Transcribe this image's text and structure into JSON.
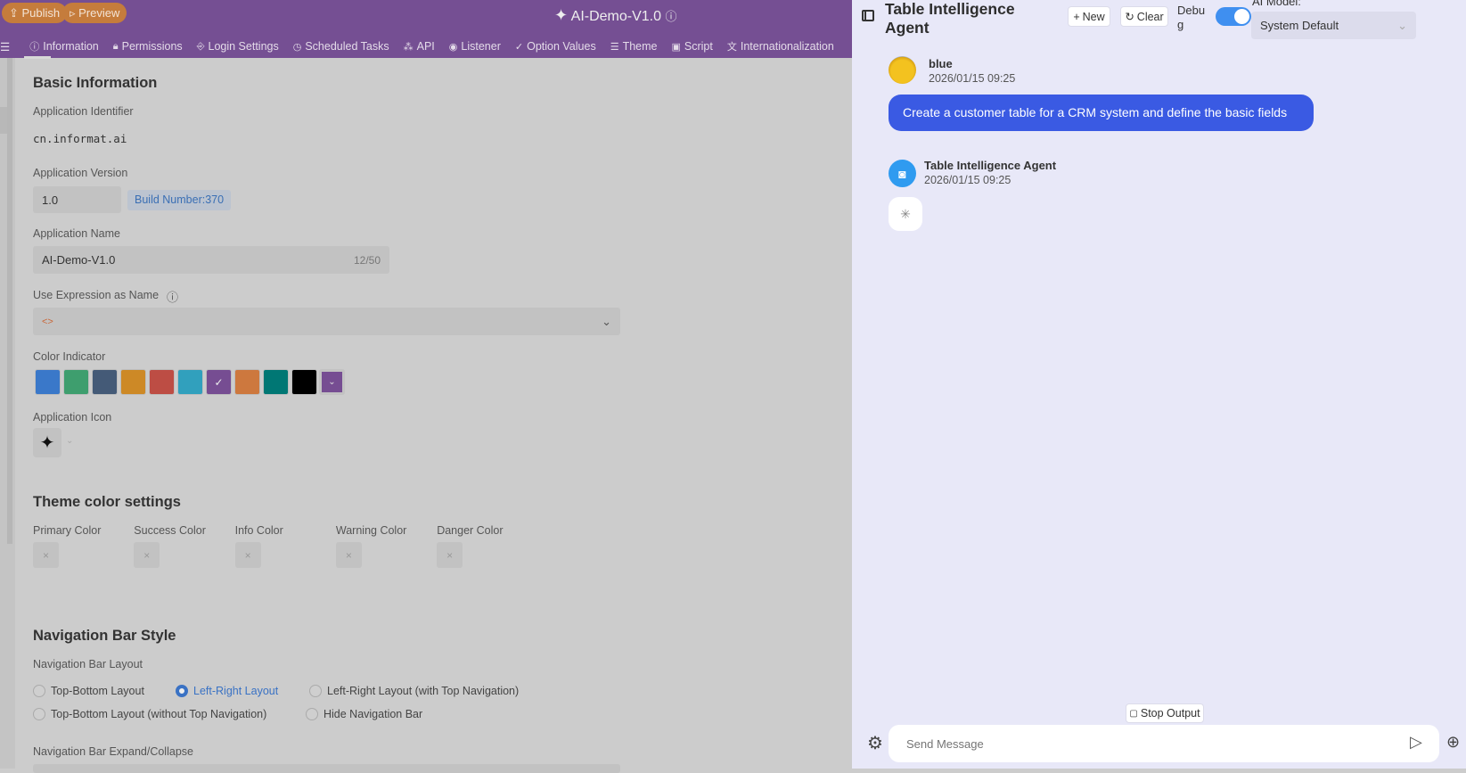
{
  "topbar": {
    "publish": "Publish",
    "preview": "Preview",
    "title": "AI-Demo-V1.0"
  },
  "tabs": [
    {
      "label": "Information",
      "icon": "info-icon",
      "g": "ⓘ"
    },
    {
      "label": "Permissions",
      "icon": "lock-icon",
      "g": "🔒︎"
    },
    {
      "label": "Login Settings",
      "icon": "login-icon",
      "g": "⎆"
    },
    {
      "label": "Scheduled Tasks",
      "icon": "clock-icon",
      "g": "◷"
    },
    {
      "label": "API",
      "icon": "api-icon",
      "g": "⁂"
    },
    {
      "label": "Listener",
      "icon": "eye-icon",
      "g": "◉"
    },
    {
      "label": "Option Values",
      "icon": "check-circle-icon",
      "g": "✓"
    },
    {
      "label": "Theme",
      "icon": "theme-icon",
      "g": "☰"
    },
    {
      "label": "Script",
      "icon": "script-icon",
      "g": "▣"
    },
    {
      "label": "Internationalization",
      "icon": "translate-icon",
      "g": "文"
    }
  ],
  "basic": {
    "title": "Basic Information",
    "identifier_label": "Application Identifier",
    "identifier": "cn.informat.ai",
    "version_label": "Application Version",
    "version": "1.0",
    "build": "Build Number:370",
    "name_label": "Application Name",
    "name": "AI-Demo-V1.0",
    "name_count": "12/50",
    "expr_label": "Use Expression as Name",
    "color_label": "Color Indicator",
    "icon_label": "Application Icon"
  },
  "colors": [
    "#3a78c9",
    "#3e9e6e",
    "#445a77",
    "#cd8926",
    "#bd4d44",
    "#31a0bd",
    "#764d92",
    "#cd783e",
    "#007774",
    "#000000"
  ],
  "selected_color": "#764d92",
  "theme": {
    "title": "Theme color settings",
    "labels": [
      "Primary Color",
      "Success Color",
      "Info Color",
      "Warning Color",
      "Danger Color"
    ]
  },
  "nav": {
    "title": "Navigation Bar Style",
    "layout_label": "Navigation Bar Layout",
    "options": [
      "Top-Bottom Layout",
      "Left-Right Layout",
      "Left-Right Layout (with Top Navigation)",
      "Top-Bottom Layout (without Top Navigation)",
      "Hide Navigation Bar"
    ],
    "selected": "Left-Right Layout",
    "expand_label": "Navigation Bar Expand/Collapse"
  },
  "panel": {
    "title_line1": "Table Intelligence",
    "title_line2": "Agent",
    "new": "New",
    "clear": "Clear",
    "debug1": "Debu",
    "debug2": "g",
    "debug_on": true,
    "model_label": "AI Model:",
    "model": "System Default",
    "stop": "Stop Output",
    "placeholder": "Send Message"
  },
  "messages": [
    {
      "name": "blue",
      "time": "2026/01/15 09:25",
      "text": "Create a customer table for a CRM system and define the basic fields"
    },
    {
      "name": "Table Intelligence Agent",
      "time": "2026/01/15 09:25",
      "status": "loading"
    }
  ]
}
